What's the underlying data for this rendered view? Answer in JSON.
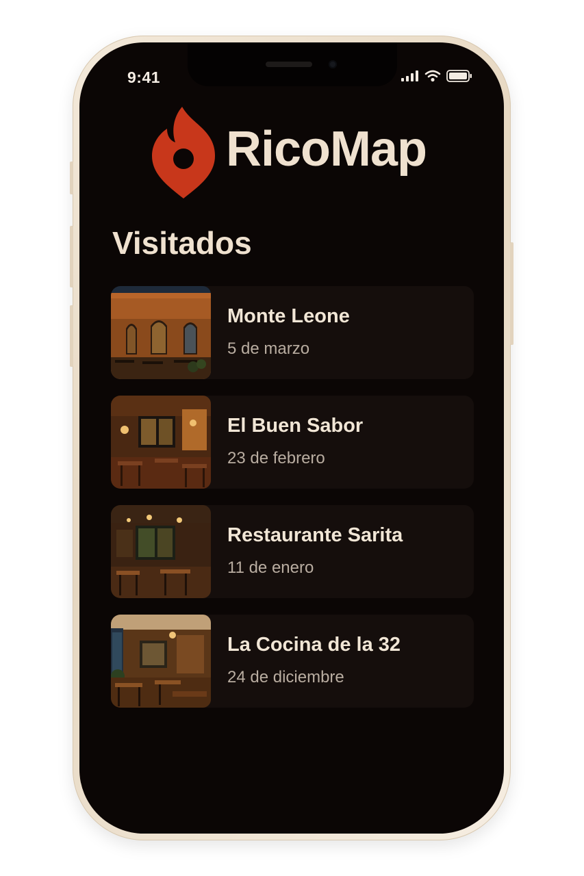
{
  "status_bar": {
    "time": "9:41",
    "icons": [
      "signal-icon",
      "wifi-icon",
      "battery-icon"
    ]
  },
  "app": {
    "title": "RicoMap",
    "logo_icon": "flame-pin-logo-icon",
    "brand_color": "#c8371b"
  },
  "section": {
    "title": "Visitados"
  },
  "visited": [
    {
      "name": "Monte Leone",
      "date": "5 de marzo",
      "photo": "restaurant-exterior-photo"
    },
    {
      "name": "El Buen Sabor",
      "date": "23 de febrero",
      "photo": "restaurant-interior-photo"
    },
    {
      "name": "Restaurante Sarita",
      "date": "11 de enero",
      "photo": "restaurant-interior-photo"
    },
    {
      "name": "La Cocina de la 32",
      "date": "24 de diciembre",
      "photo": "restaurant-interior-photo"
    }
  ],
  "colors": {
    "background": "#0b0605",
    "card": "#150e0c",
    "text_primary": "#efe1cf",
    "text_secondary": "#b9ada1"
  }
}
